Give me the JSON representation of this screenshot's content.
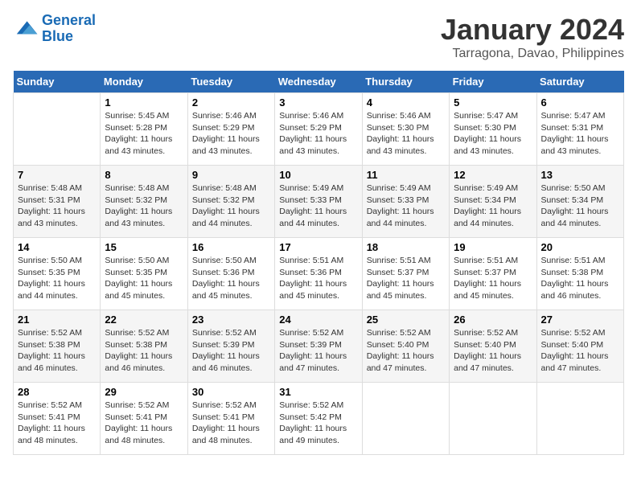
{
  "logo": {
    "line1": "General",
    "line2": "Blue"
  },
  "title": "January 2024",
  "subtitle": "Tarragona, Davao, Philippines",
  "days_header": [
    "Sunday",
    "Monday",
    "Tuesday",
    "Wednesday",
    "Thursday",
    "Friday",
    "Saturday"
  ],
  "weeks": [
    [
      {
        "num": "",
        "info": ""
      },
      {
        "num": "1",
        "info": "Sunrise: 5:45 AM\nSunset: 5:28 PM\nDaylight: 11 hours\nand 43 minutes."
      },
      {
        "num": "2",
        "info": "Sunrise: 5:46 AM\nSunset: 5:29 PM\nDaylight: 11 hours\nand 43 minutes."
      },
      {
        "num": "3",
        "info": "Sunrise: 5:46 AM\nSunset: 5:29 PM\nDaylight: 11 hours\nand 43 minutes."
      },
      {
        "num": "4",
        "info": "Sunrise: 5:46 AM\nSunset: 5:30 PM\nDaylight: 11 hours\nand 43 minutes."
      },
      {
        "num": "5",
        "info": "Sunrise: 5:47 AM\nSunset: 5:30 PM\nDaylight: 11 hours\nand 43 minutes."
      },
      {
        "num": "6",
        "info": "Sunrise: 5:47 AM\nSunset: 5:31 PM\nDaylight: 11 hours\nand 43 minutes."
      }
    ],
    [
      {
        "num": "7",
        "info": "Sunrise: 5:48 AM\nSunset: 5:31 PM\nDaylight: 11 hours\nand 43 minutes."
      },
      {
        "num": "8",
        "info": "Sunrise: 5:48 AM\nSunset: 5:32 PM\nDaylight: 11 hours\nand 43 minutes."
      },
      {
        "num": "9",
        "info": "Sunrise: 5:48 AM\nSunset: 5:32 PM\nDaylight: 11 hours\nand 44 minutes."
      },
      {
        "num": "10",
        "info": "Sunrise: 5:49 AM\nSunset: 5:33 PM\nDaylight: 11 hours\nand 44 minutes."
      },
      {
        "num": "11",
        "info": "Sunrise: 5:49 AM\nSunset: 5:33 PM\nDaylight: 11 hours\nand 44 minutes."
      },
      {
        "num": "12",
        "info": "Sunrise: 5:49 AM\nSunset: 5:34 PM\nDaylight: 11 hours\nand 44 minutes."
      },
      {
        "num": "13",
        "info": "Sunrise: 5:50 AM\nSunset: 5:34 PM\nDaylight: 11 hours\nand 44 minutes."
      }
    ],
    [
      {
        "num": "14",
        "info": "Sunrise: 5:50 AM\nSunset: 5:35 PM\nDaylight: 11 hours\nand 44 minutes."
      },
      {
        "num": "15",
        "info": "Sunrise: 5:50 AM\nSunset: 5:35 PM\nDaylight: 11 hours\nand 45 minutes."
      },
      {
        "num": "16",
        "info": "Sunrise: 5:50 AM\nSunset: 5:36 PM\nDaylight: 11 hours\nand 45 minutes."
      },
      {
        "num": "17",
        "info": "Sunrise: 5:51 AM\nSunset: 5:36 PM\nDaylight: 11 hours\nand 45 minutes."
      },
      {
        "num": "18",
        "info": "Sunrise: 5:51 AM\nSunset: 5:37 PM\nDaylight: 11 hours\nand 45 minutes."
      },
      {
        "num": "19",
        "info": "Sunrise: 5:51 AM\nSunset: 5:37 PM\nDaylight: 11 hours\nand 45 minutes."
      },
      {
        "num": "20",
        "info": "Sunrise: 5:51 AM\nSunset: 5:38 PM\nDaylight: 11 hours\nand 46 minutes."
      }
    ],
    [
      {
        "num": "21",
        "info": "Sunrise: 5:52 AM\nSunset: 5:38 PM\nDaylight: 11 hours\nand 46 minutes."
      },
      {
        "num": "22",
        "info": "Sunrise: 5:52 AM\nSunset: 5:38 PM\nDaylight: 11 hours\nand 46 minutes."
      },
      {
        "num": "23",
        "info": "Sunrise: 5:52 AM\nSunset: 5:39 PM\nDaylight: 11 hours\nand 46 minutes."
      },
      {
        "num": "24",
        "info": "Sunrise: 5:52 AM\nSunset: 5:39 PM\nDaylight: 11 hours\nand 47 minutes."
      },
      {
        "num": "25",
        "info": "Sunrise: 5:52 AM\nSunset: 5:40 PM\nDaylight: 11 hours\nand 47 minutes."
      },
      {
        "num": "26",
        "info": "Sunrise: 5:52 AM\nSunset: 5:40 PM\nDaylight: 11 hours\nand 47 minutes."
      },
      {
        "num": "27",
        "info": "Sunrise: 5:52 AM\nSunset: 5:40 PM\nDaylight: 11 hours\nand 47 minutes."
      }
    ],
    [
      {
        "num": "28",
        "info": "Sunrise: 5:52 AM\nSunset: 5:41 PM\nDaylight: 11 hours\nand 48 minutes."
      },
      {
        "num": "29",
        "info": "Sunrise: 5:52 AM\nSunset: 5:41 PM\nDaylight: 11 hours\nand 48 minutes."
      },
      {
        "num": "30",
        "info": "Sunrise: 5:52 AM\nSunset: 5:41 PM\nDaylight: 11 hours\nand 48 minutes."
      },
      {
        "num": "31",
        "info": "Sunrise: 5:52 AM\nSunset: 5:42 PM\nDaylight: 11 hours\nand 49 minutes."
      },
      {
        "num": "",
        "info": ""
      },
      {
        "num": "",
        "info": ""
      },
      {
        "num": "",
        "info": ""
      }
    ]
  ]
}
